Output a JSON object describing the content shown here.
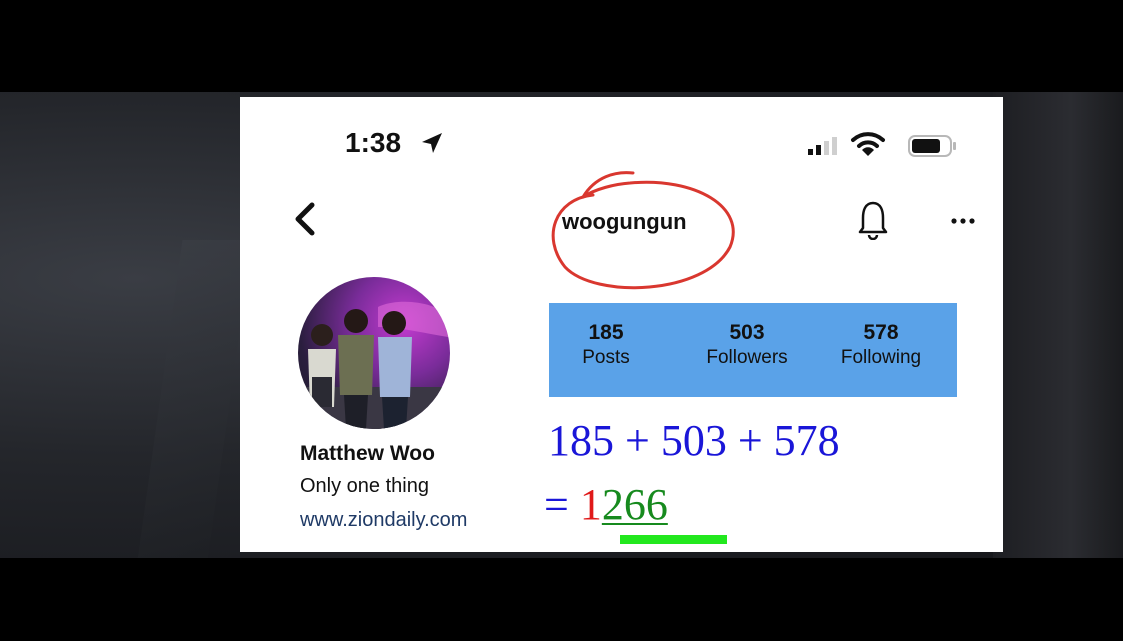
{
  "status_bar": {
    "time": "1:38",
    "icons": [
      "location-arrow-icon",
      "signal-icon",
      "wifi-icon",
      "battery-icon"
    ]
  },
  "header": {
    "username": "woogungun",
    "icons": [
      "back-chevron-icon",
      "bell-icon",
      "more-icon"
    ],
    "annotation_color": "#d9372f"
  },
  "profile": {
    "display_name": "Matthew Woo",
    "bio": "Only one thing",
    "website": "www.ziondaily.com"
  },
  "stats": {
    "highlight_color": "#5aa2e8",
    "items": [
      {
        "value": "185",
        "label": "Posts"
      },
      {
        "value": "503",
        "label": "Followers"
      },
      {
        "value": "578",
        "label": "Following"
      }
    ]
  },
  "annotation": {
    "equation": "185 + 503 + 578",
    "equals": "=",
    "result_first_digit": "1",
    "result_rest": "266",
    "colors": {
      "equation": "#1a16d8",
      "first_digit": "#e01919",
      "rest": "#178a1e",
      "underline_bar": "#22e81e"
    }
  }
}
